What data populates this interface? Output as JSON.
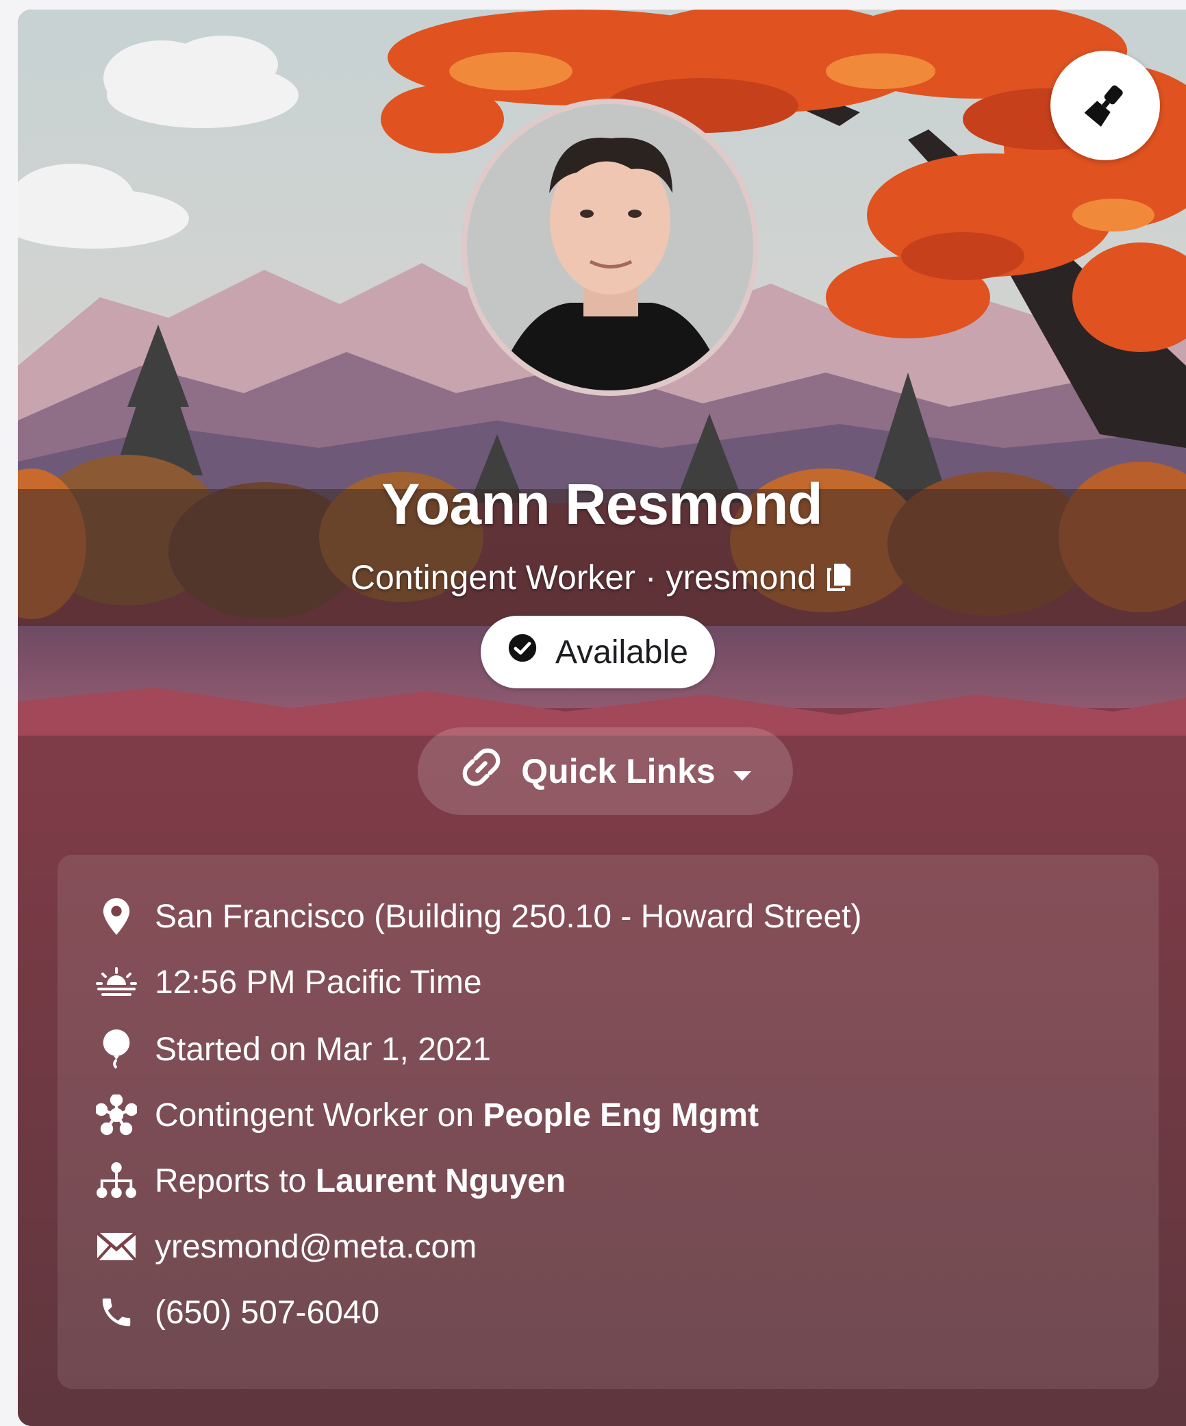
{
  "profile": {
    "name": "Yoann Resmond",
    "role": "Contingent Worker",
    "separator": "·",
    "username": "yresmond"
  },
  "status": {
    "label": "Available"
  },
  "quick_links": {
    "label": "Quick Links"
  },
  "info": {
    "location": "San Francisco (Building 250.10 - Howard Street)",
    "local_time": "12:56 PM Pacific Time",
    "start_date": "Started on Mar 1, 2021",
    "team_prefix": "Contingent Worker on",
    "team_name": "People Eng Mgmt",
    "reports_prefix": "Reports to",
    "manager": "Laurent Nguyen",
    "email": "yresmond@meta.com",
    "phone": "(650) 507-6040"
  },
  "colors": {
    "card_bottom": "#6b3a43",
    "lake": "#9a4656",
    "foliage": "#e0521f",
    "accent_text": "#ffffff"
  },
  "icons": {
    "customize": "paint-brush-icon",
    "copy": "copy-icon",
    "status": "check-circle-icon",
    "quick_links": "link-icon",
    "location": "location-pin-icon",
    "time": "sunrise-icon",
    "start": "balloon-icon",
    "team": "team-network-icon",
    "reports": "org-chart-icon",
    "email": "envelope-icon",
    "phone": "phone-icon"
  }
}
